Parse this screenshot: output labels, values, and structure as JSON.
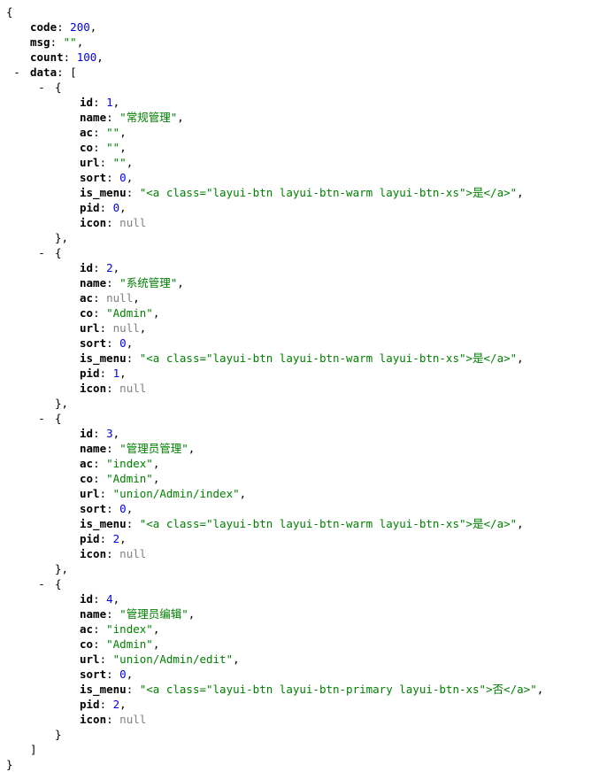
{
  "symbols": {
    "open_brace": "{",
    "close_brace": "}",
    "close_brace_comma": "},",
    "open_bracket": "[",
    "close_bracket": "]",
    "collapse_toggle": "-",
    "colon": ": ",
    "comma": ","
  },
  "root": {
    "fields": [
      {
        "key": "code",
        "value": "200",
        "type": "number"
      },
      {
        "key": "msg",
        "value": "\"\"",
        "type": "string"
      },
      {
        "key": "count",
        "value": "100",
        "type": "number"
      }
    ],
    "array_key": "data"
  },
  "items": [
    {
      "fields": [
        {
          "key": "id",
          "value": "1",
          "type": "number"
        },
        {
          "key": "name",
          "value": "\"常规管理\"",
          "type": "string"
        },
        {
          "key": "ac",
          "value": "\"\"",
          "type": "string"
        },
        {
          "key": "co",
          "value": "\"\"",
          "type": "string"
        },
        {
          "key": "url",
          "value": "\"\"",
          "type": "string"
        },
        {
          "key": "sort",
          "value": "0",
          "type": "number"
        },
        {
          "key": "is_menu",
          "value": "\"<a class=\"layui-btn layui-btn-warm layui-btn-xs\">是</a>\"",
          "type": "string"
        },
        {
          "key": "pid",
          "value": "0",
          "type": "number"
        },
        {
          "key": "icon",
          "value": "null",
          "type": "null"
        }
      ]
    },
    {
      "fields": [
        {
          "key": "id",
          "value": "2",
          "type": "number"
        },
        {
          "key": "name",
          "value": "\"系统管理\"",
          "type": "string"
        },
        {
          "key": "ac",
          "value": "null",
          "type": "null"
        },
        {
          "key": "co",
          "value": "\"Admin\"",
          "type": "string"
        },
        {
          "key": "url",
          "value": "null",
          "type": "null"
        },
        {
          "key": "sort",
          "value": "0",
          "type": "number"
        },
        {
          "key": "is_menu",
          "value": "\"<a class=\"layui-btn layui-btn-warm layui-btn-xs\">是</a>\"",
          "type": "string"
        },
        {
          "key": "pid",
          "value": "1",
          "type": "number"
        },
        {
          "key": "icon",
          "value": "null",
          "type": "null"
        }
      ]
    },
    {
      "fields": [
        {
          "key": "id",
          "value": "3",
          "type": "number"
        },
        {
          "key": "name",
          "value": "\"管理员管理\"",
          "type": "string"
        },
        {
          "key": "ac",
          "value": "\"index\"",
          "type": "string"
        },
        {
          "key": "co",
          "value": "\"Admin\"",
          "type": "string"
        },
        {
          "key": "url",
          "value": "\"union/Admin/index\"",
          "type": "string"
        },
        {
          "key": "sort",
          "value": "0",
          "type": "number"
        },
        {
          "key": "is_menu",
          "value": "\"<a class=\"layui-btn layui-btn-warm layui-btn-xs\">是</a>\"",
          "type": "string"
        },
        {
          "key": "pid",
          "value": "2",
          "type": "number"
        },
        {
          "key": "icon",
          "value": "null",
          "type": "null"
        }
      ]
    },
    {
      "fields": [
        {
          "key": "id",
          "value": "4",
          "type": "number"
        },
        {
          "key": "name",
          "value": "\"管理员编辑\"",
          "type": "string"
        },
        {
          "key": "ac",
          "value": "\"index\"",
          "type": "string"
        },
        {
          "key": "co",
          "value": "\"Admin\"",
          "type": "string"
        },
        {
          "key": "url",
          "value": "\"union/Admin/edit\"",
          "type": "string"
        },
        {
          "key": "sort",
          "value": "0",
          "type": "number"
        },
        {
          "key": "is_menu",
          "value": "\"<a class=\"layui-btn layui-btn-primary layui-btn-xs\">否</a>\"",
          "type": "string"
        },
        {
          "key": "pid",
          "value": "2",
          "type": "number"
        },
        {
          "key": "icon",
          "value": "null",
          "type": "null"
        }
      ]
    }
  ]
}
